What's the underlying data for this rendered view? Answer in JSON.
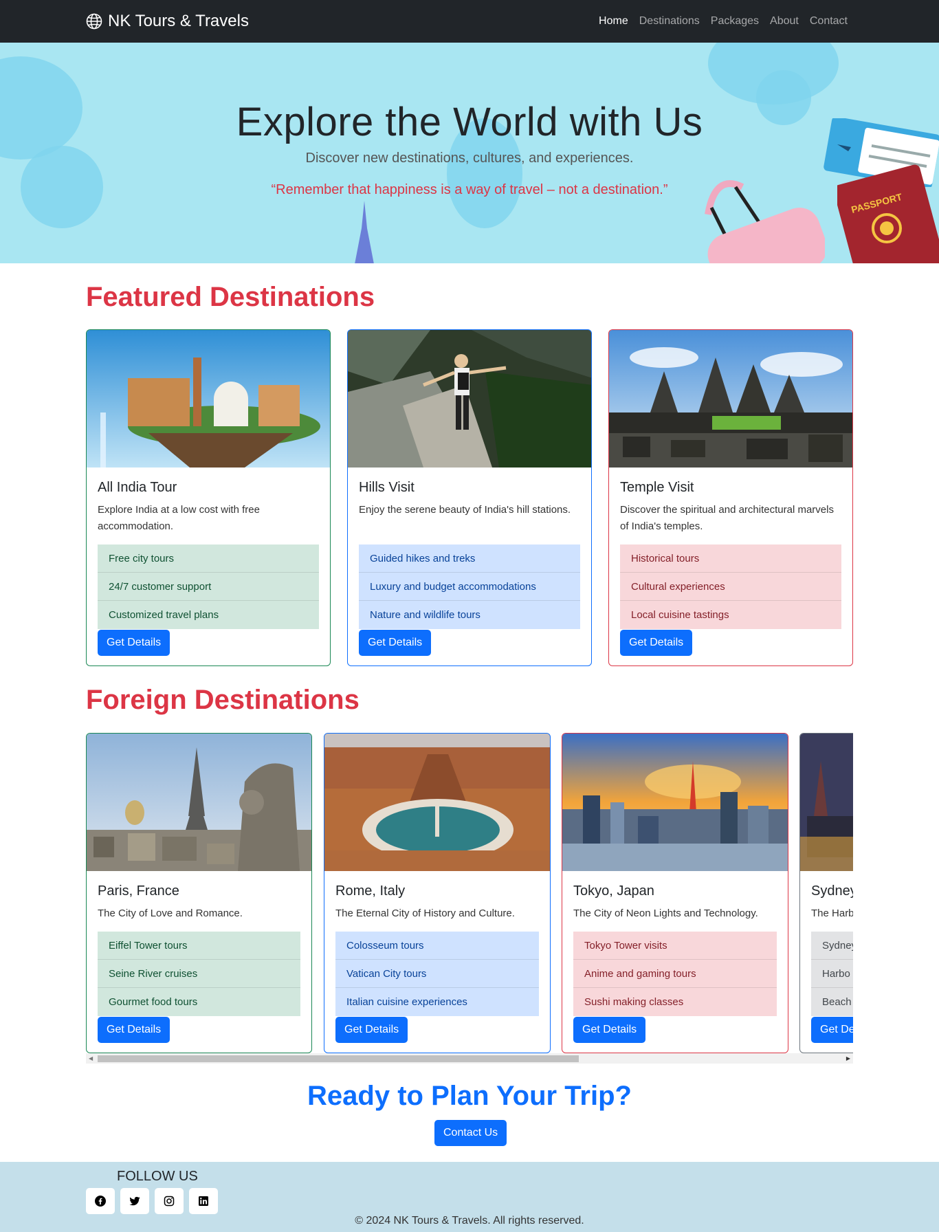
{
  "nav": {
    "brand": "NK Tours & Travels",
    "links": [
      "Home",
      "Destinations",
      "Packages",
      "About",
      "Contact"
    ]
  },
  "hero": {
    "title": "Explore the World with Us",
    "subtitle": "Discover new destinations, cultures, and experiences.",
    "quote": "“Remember that happiness is a way of travel – not a destination.”",
    "passport_label": "PASSPORT"
  },
  "featured": {
    "title": "Featured Destinations",
    "cards": [
      {
        "title": "All India Tour",
        "text": "Explore India at a low cost with free accommodation.",
        "items": [
          "Free city tours",
          "24/7 customer support",
          "Customized travel plans"
        ],
        "button": "Get Details"
      },
      {
        "title": "Hills Visit",
        "text": "Enjoy the serene beauty of India's hill stations.",
        "items": [
          "Guided hikes and treks",
          "Luxury and budget accommodations",
          "Nature and wildlife tours"
        ],
        "button": "Get Details"
      },
      {
        "title": "Temple Visit",
        "text": "Discover the spiritual and architectural marvels of India's temples.",
        "items": [
          "Historical tours",
          "Cultural experiences",
          "Local cuisine tastings"
        ],
        "button": "Get Details"
      }
    ]
  },
  "foreign": {
    "title": "Foreign Destinations",
    "cards": [
      {
        "title": "Paris, France",
        "text": "The City of Love and Romance.",
        "items": [
          "Eiffel Tower tours",
          "Seine River cruises",
          "Gourmet food tours"
        ],
        "button": "Get Details"
      },
      {
        "title": "Rome, Italy",
        "text": "The Eternal City of History and Culture.",
        "items": [
          "Colosseum tours",
          "Vatican City tours",
          "Italian cuisine experiences"
        ],
        "button": "Get Details"
      },
      {
        "title": "Tokyo, Japan",
        "text": "The City of Neon Lights and Technology.",
        "items": [
          "Tokyo Tower visits",
          "Anime and gaming tours",
          "Sushi making classes"
        ],
        "button": "Get Details"
      },
      {
        "title": "Sydney",
        "text": "The Harb",
        "items": [
          "Sydney",
          "Harbo",
          "Beach"
        ],
        "button": "Get De"
      }
    ]
  },
  "cta": {
    "title": "Ready to Plan Your Trip?",
    "button": "Contact Us"
  },
  "footer": {
    "follow": "FOLLOW US",
    "socials": [
      "facebook-icon",
      "twitter-icon",
      "instagram-icon",
      "linkedin-icon"
    ],
    "copyright": "© 2024 NK Tours & Travels. All rights reserved."
  },
  "colors": {
    "nav_bg": "#212529",
    "hero_bg": "#a9e6f2",
    "accent_red": "#dc3545",
    "primary_blue": "#0d6efd",
    "footer_bg": "#c4dfea"
  }
}
